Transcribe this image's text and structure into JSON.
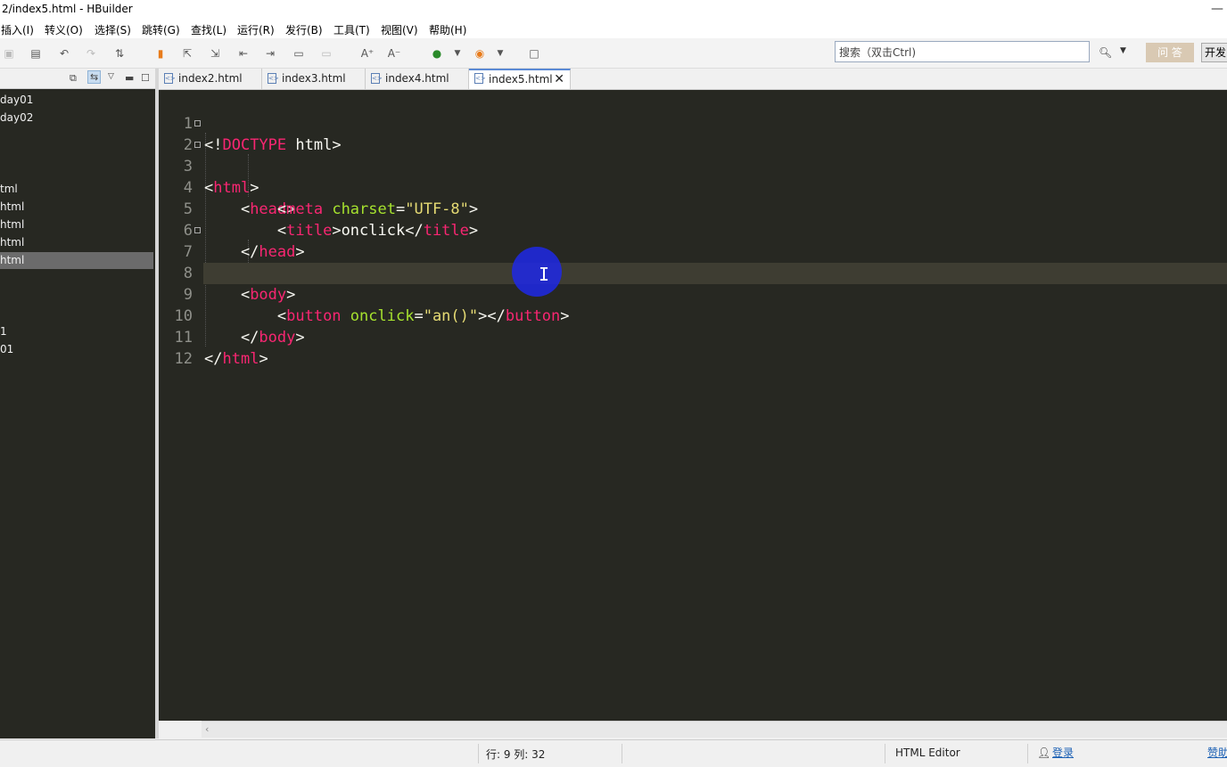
{
  "window": {
    "title": "2/index5.html  -  HBuilder"
  },
  "menu": [
    "插入(I)",
    "转义(O)",
    "选择(S)",
    "跳转(G)",
    "查找(L)",
    "运行(R)",
    "发行(B)",
    "工具(T)",
    "视图(V)",
    "帮助(H)"
  ],
  "toolbar": {
    "search_placeholder": "搜索（双击Ctrl)",
    "ask_label": "问 答",
    "dev_label": "开发"
  },
  "sidebar": {
    "items": [
      "day01",
      "day02",
      "tml",
      "html",
      "html",
      "html",
      "html",
      "1",
      "01"
    ],
    "selected_index": 6
  },
  "tabs": [
    {
      "label": "index2.html"
    },
    {
      "label": "index3.html"
    },
    {
      "label": "index4.html"
    },
    {
      "label": "index5.html",
      "active": true
    }
  ],
  "editor": {
    "line_numbers": [
      "1",
      "2",
      "3",
      "4",
      "5",
      "6",
      "7",
      "8",
      "9",
      "10",
      "11",
      "12"
    ],
    "current_line": 9,
    "code": {
      "l1_punct": "<!",
      "l1_doctype": "DOCTYPE",
      "l1_rest": " html>",
      "l2_tag": "html",
      "l3_tag": "head",
      "l4_tag": "meta",
      "l4_attr": "charset",
      "l4_val": "\"UTF-8\"",
      "l5_tag": "title",
      "l5_text": "onclick",
      "l6_tag": "head",
      "l7_tag": "body",
      "l9_tag": "button",
      "l9_attr": "onclick",
      "l9_val_open": "\"an()",
      "l9_val_close": "\"",
      "l10_tag": "body",
      "l11_tag": "html"
    }
  },
  "status": {
    "position": "行: 9 列: 32",
    "editor_mode": "HTML Editor",
    "login": "登录",
    "sponsor": "赞助"
  },
  "colors": {
    "editor_bg": "#272822",
    "tag": "#f92672",
    "attr": "#a6e22e",
    "string": "#e6db74",
    "text": "#f8f8f2"
  }
}
